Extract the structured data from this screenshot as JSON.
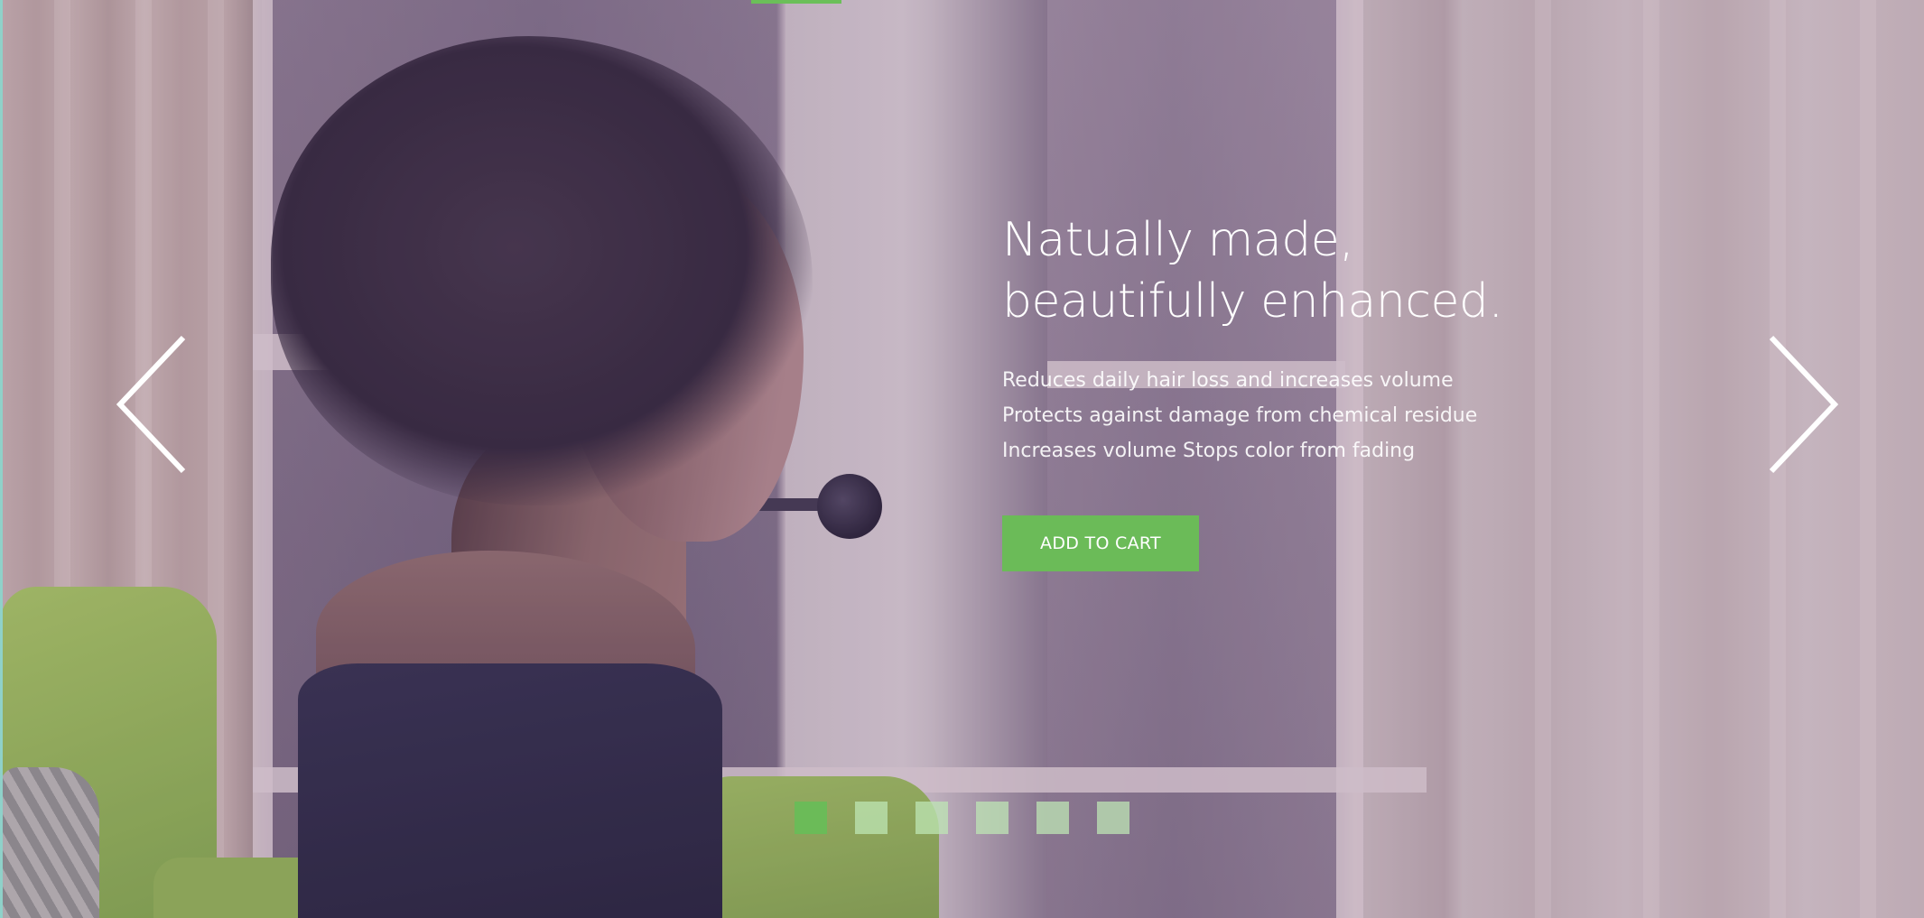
{
  "hero": {
    "headline_line1": "Natually made,",
    "headline_line2": "beautifully enhanced.",
    "features": [
      "Reduces daily hair loss and increases volume",
      "Protects against damage from chemical residue",
      "Increases volume Stops color from fading"
    ],
    "cta_label": "ADD TO CART"
  },
  "carousel": {
    "slide_count": 6,
    "active_index": 0,
    "prev_icon": "chevron-left-icon",
    "next_icon": "chevron-right-icon"
  },
  "colors": {
    "accent": "#6bbb58",
    "inactive_dot": "#bfe6b4",
    "text": "#ffffff"
  }
}
